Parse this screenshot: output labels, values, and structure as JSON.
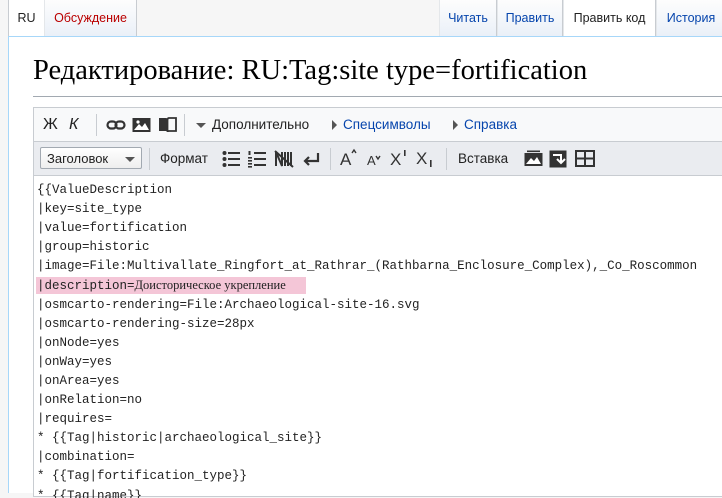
{
  "tabs": {
    "language": "RU",
    "discussion": "Обсуждение",
    "read": "Читать",
    "edit": "Править",
    "edit_source": "Править код",
    "history": "История"
  },
  "page": {
    "title": "Редактирование: RU:Tag:site type=fortification"
  },
  "toolbar": {
    "bold": "Ж",
    "italic": "К",
    "advanced": "Дополнительно",
    "special_chars": "Спецсимволы",
    "help": "Справка",
    "heading_select": "Заголовок",
    "format": "Формат",
    "insert": "Вставка",
    "icons": [
      "link-icon",
      "image-icon",
      "book-icon",
      "bulleted-list-icon",
      "numbered-list-icon",
      "nowiki-icon",
      "newline-icon",
      "big-text-icon",
      "small-text-icon",
      "superscript-icon",
      "subscript-icon",
      "gallery-icon",
      "redirect-icon",
      "table-icon"
    ]
  },
  "wikitext": {
    "lines": [
      "{{ValueDescription",
      "|key=site_type",
      "|value=fortification",
      "|group=historic",
      "|image=File:Multivallate_Ringfort_at_Rathrar_(Rathbarna_Enclosure_Complex),_Co_Roscommon",
      "|description=",
      "|osmcarto-rendering=File:Archaeological-site-16.svg",
      "|osmcarto-rendering-size=28px",
      "|onNode=yes",
      "|onWay=yes",
      "|onArea=yes",
      "|onRelation=no",
      "|requires=",
      "* {{Tag|historic|archaeological_site}}",
      "|combination=",
      "* {{Tag|fortification_type}}",
      "* {{Tag|name}}"
    ],
    "description_value": "Доисторическое укрепление"
  },
  "colors": {
    "highlight": "#f4c6d7",
    "link": "#0645ad",
    "redlink": "#ba0000"
  }
}
